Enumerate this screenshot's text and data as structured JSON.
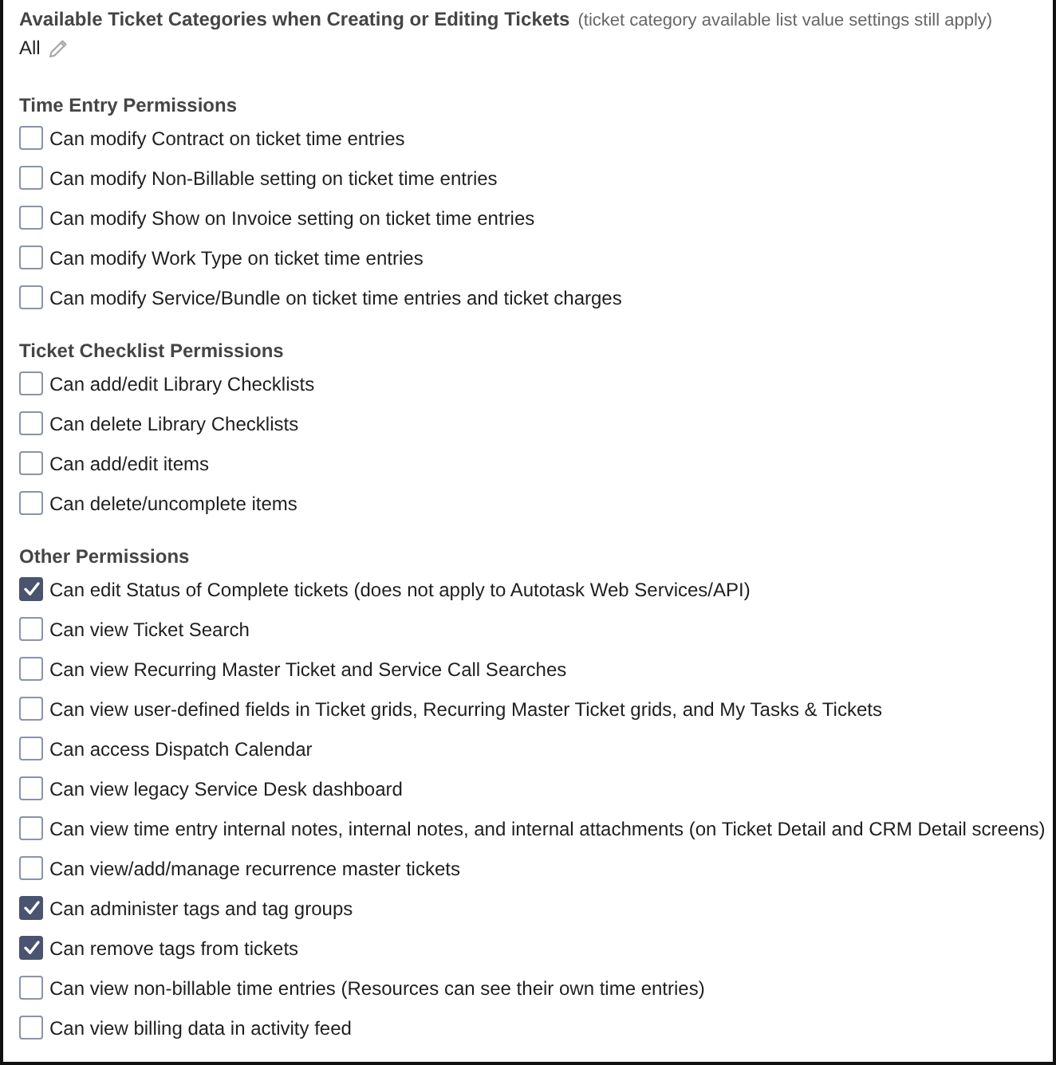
{
  "categories": {
    "title": "Available Ticket Categories when Creating or Editing Tickets",
    "note": "(ticket category available list value settings still apply)",
    "value": "All"
  },
  "sections": [
    {
      "title": "Time Entry Permissions",
      "items": [
        {
          "label": "Can modify Contract on ticket time entries",
          "checked": false
        },
        {
          "label": "Can modify Non-Billable setting on ticket time entries",
          "checked": false
        },
        {
          "label": "Can modify Show on Invoice setting on ticket time entries",
          "checked": false
        },
        {
          "label": "Can modify Work Type on ticket time entries",
          "checked": false
        },
        {
          "label": "Can modify Service/Bundle on ticket time entries and ticket charges",
          "checked": false
        }
      ]
    },
    {
      "title": "Ticket Checklist Permissions",
      "items": [
        {
          "label": "Can add/edit Library Checklists",
          "checked": false
        },
        {
          "label": "Can delete Library Checklists",
          "checked": false
        },
        {
          "label": "Can add/edit items",
          "checked": false
        },
        {
          "label": "Can delete/uncomplete items",
          "checked": false
        }
      ]
    },
    {
      "title": "Other Permissions",
      "items": [
        {
          "label": "Can edit Status of Complete tickets (does not apply to Autotask Web Services/API)",
          "checked": true
        },
        {
          "label": "Can view Ticket Search",
          "checked": false
        },
        {
          "label": "Can view Recurring Master Ticket and Service Call Searches",
          "checked": false
        },
        {
          "label": "Can view user-defined fields in Ticket grids, Recurring Master Ticket grids, and My Tasks & Tickets",
          "checked": false
        },
        {
          "label": "Can access Dispatch Calendar",
          "checked": false
        },
        {
          "label": "Can view legacy Service Desk dashboard",
          "checked": false
        },
        {
          "label": "Can view time entry internal notes, internal notes, and internal attachments (on Ticket Detail and CRM Detail screens)",
          "checked": false
        },
        {
          "label": "Can view/add/manage recurrence master tickets",
          "checked": false
        },
        {
          "label": "Can administer tags and tag groups",
          "checked": true
        },
        {
          "label": "Can remove tags from tickets",
          "checked": true
        },
        {
          "label": "Can view non-billable time entries (Resources can see their own time entries)",
          "checked": false
        },
        {
          "label": "Can view billing data in activity feed",
          "checked": false
        }
      ]
    }
  ]
}
